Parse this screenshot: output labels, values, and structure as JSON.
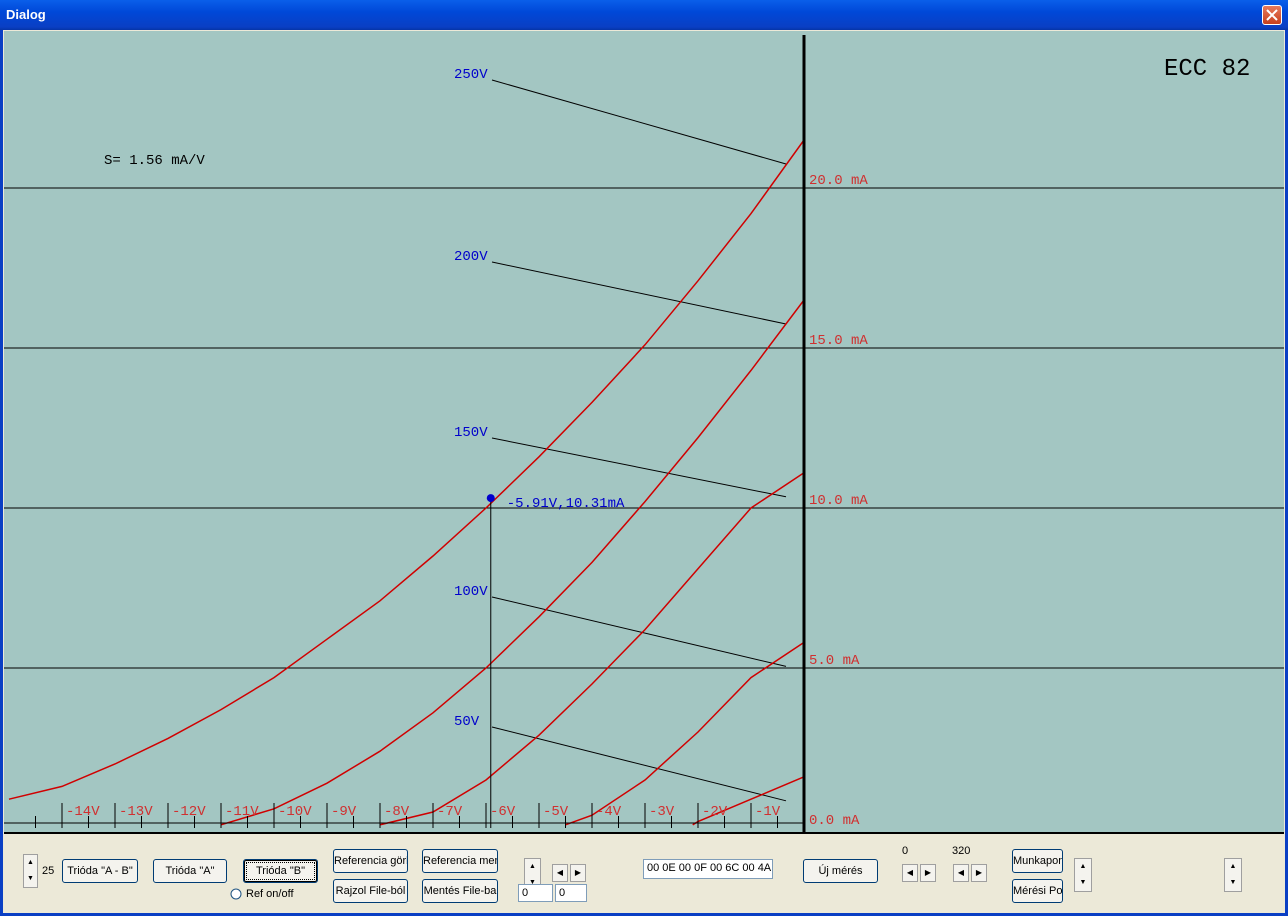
{
  "window": {
    "title": "Dialog"
  },
  "chart_data": {
    "type": "line",
    "title": "ECC 82",
    "annotation": "S= 1.56 mA/V",
    "marker": {
      "x": -5.91,
      "y": 10.31,
      "label": "-5.91V,10.31mA"
    },
    "x_tick_labels": [
      "-14V",
      "-13V",
      "-12V",
      "-11V",
      "-10V",
      "-9V",
      "-8V",
      "-7V",
      "-6V",
      "-5V",
      "-4V",
      "-3V",
      "-2V",
      "-1V"
    ],
    "y_tick_labels": [
      "0.0 mA",
      "5.0 mA",
      "10.0 mA",
      "15.0 mA",
      "20.0 mA"
    ],
    "xlim": [
      -15,
      0
    ],
    "ylim": [
      0,
      22.5
    ],
    "series": [
      {
        "name": "250V",
        "x": [
          -15,
          -14,
          -13,
          -12,
          -11,
          -10,
          -9,
          -8,
          -7,
          -6,
          -5,
          -4,
          -3,
          -2,
          -1,
          0
        ],
        "values": [
          0.9,
          1.3,
          2.0,
          2.8,
          3.7,
          4.7,
          5.9,
          7.1,
          8.5,
          10.0,
          11.6,
          13.3,
          15.1,
          17.1,
          19.2,
          21.5
        ]
      },
      {
        "name": "200V",
        "x": [
          -11,
          -10,
          -9,
          -8,
          -7,
          -6,
          -5,
          -4,
          -3,
          -2,
          -1,
          0
        ],
        "values": [
          0.1,
          0.6,
          1.4,
          2.4,
          3.6,
          5.0,
          6.6,
          8.3,
          10.2,
          12.2,
          14.3,
          16.5
        ]
      },
      {
        "name": "150V",
        "x": [
          -8,
          -7,
          -6,
          -5,
          -4,
          -3,
          -2,
          -1,
          0
        ],
        "values": [
          0.1,
          0.5,
          1.5,
          2.9,
          4.5,
          6.2,
          8.1,
          10.0,
          11.1
        ]
      },
      {
        "name": "100V",
        "x": [
          -4.5,
          -4,
          -3,
          -2,
          -1,
          0
        ],
        "values": [
          0.1,
          0.4,
          1.5,
          3.0,
          4.7,
          5.8
        ]
      },
      {
        "name": "50V",
        "x": [
          -2.1,
          -2,
          -1,
          0
        ],
        "values": [
          0.1,
          0.2,
          0.9,
          1.6
        ]
      }
    ],
    "grid": true
  },
  "controls": {
    "spin1_value": "25",
    "trioda_ab": "Trióda \"A - B\"",
    "trioda_a": "Trióda  \"A\"",
    "trioda_b": "Trióda  \"B\"",
    "ref_onoff": "Ref on/off",
    "referencia_gorbe": "Referencia görbe",
    "referencia_mentes": "Referencia mentés",
    "rajzol_file": "Rajzol File-ból",
    "mentes_file": "Mentés File-ba",
    "field_a": "0",
    "field_b": "0",
    "hex_field": "00 0E 00 0F 00 6C 00 4A",
    "uj_meres": "Új mérés",
    "label_0": "0",
    "label_320": "320",
    "munkapont": "Munkapont",
    "meresi_pont": "Mérési Pont"
  }
}
